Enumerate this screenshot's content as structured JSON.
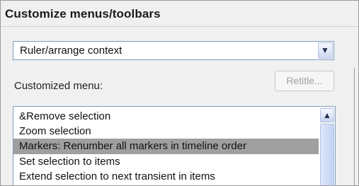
{
  "window": {
    "title": "Customize menus/toolbars"
  },
  "context_select": {
    "value": "Ruler/arrange context"
  },
  "customized_menu": {
    "label": "Customized menu:",
    "retitle_label": "Retitle...",
    "items": [
      {
        "label": "&Remove selection",
        "selected": false
      },
      {
        "label": "Zoom selection",
        "selected": false
      },
      {
        "label": "Markers: Renumber all markers in timeline order",
        "selected": true
      },
      {
        "label": "Set selection to items",
        "selected": false
      },
      {
        "label": "Extend selection to next transient in items",
        "selected": false
      }
    ]
  },
  "icons": {
    "dropdown": "chevron-down-icon",
    "scroll_up": "scroll-up-icon"
  },
  "colors": {
    "selection_bg": "#9f9f9f",
    "field_border": "#7f9db9",
    "panel_bg": "#f0f0f0"
  }
}
